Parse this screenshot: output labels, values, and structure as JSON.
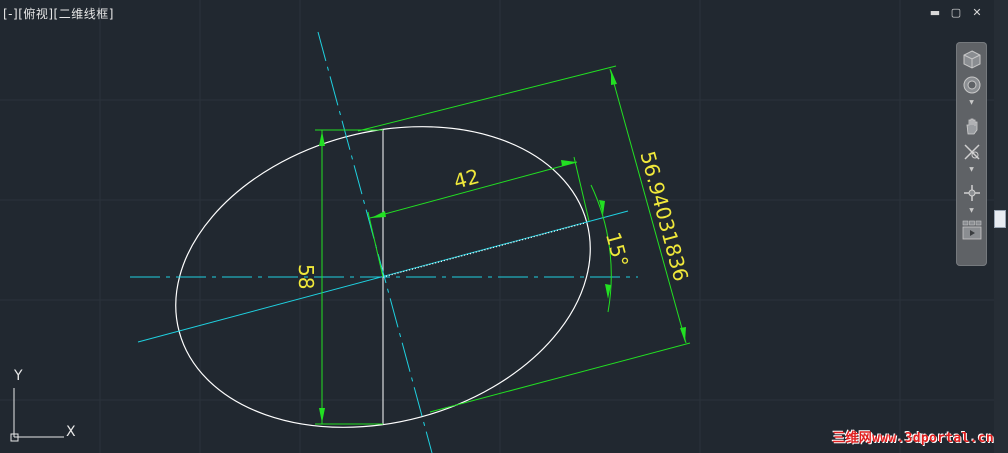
{
  "viewport": {
    "label": "[-][俯视][二维线框]",
    "controls": {
      "minimize": "▬",
      "restore": "▢",
      "close": "✕"
    }
  },
  "drawing": {
    "dimensions": {
      "width_dim": "42",
      "height_dim": "58",
      "aligned_dim": "56.94031836",
      "angle_dim": "15°"
    },
    "colors": {
      "background": "#212830",
      "geometry": "#ffffff",
      "centerline": "#1fd1e0",
      "dimension_line": "#22e022",
      "dimension_text": "#f0e83a"
    }
  },
  "ucs": {
    "x_label": "X",
    "y_label": "Y"
  },
  "navbar": {
    "tools": [
      "view-cube-icon",
      "steering-wheel-icon",
      "pan-icon",
      "zoom-icon",
      "orbit-icon",
      "show-motion-icon"
    ]
  },
  "watermark": {
    "text": "三维网www.3dportal.cn"
  }
}
